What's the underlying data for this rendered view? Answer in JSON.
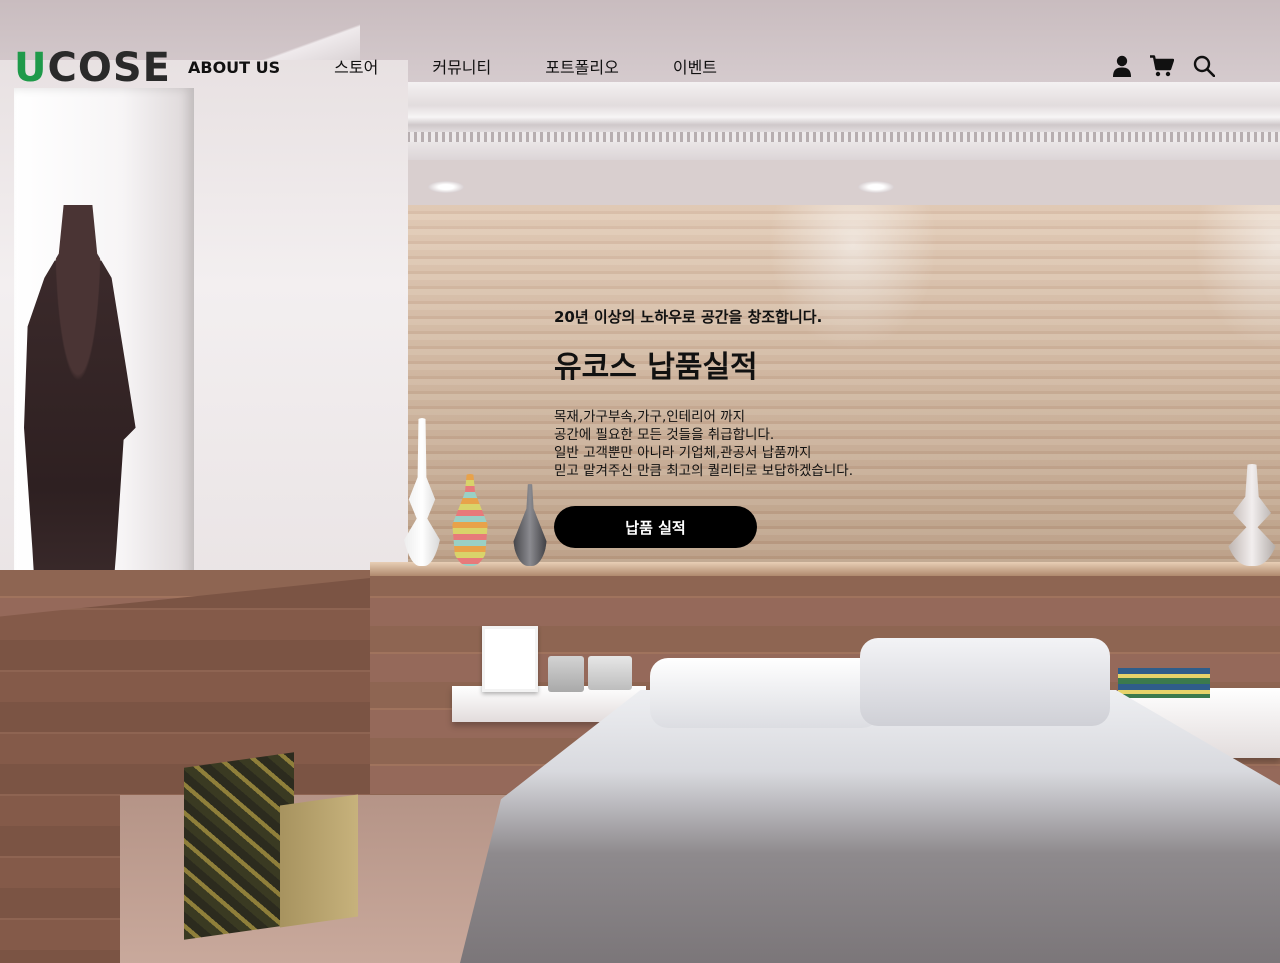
{
  "brand": {
    "logo_initial": "U",
    "logo_rest": "COSE",
    "initial_color": "#1f9a4a"
  },
  "nav": {
    "items": [
      {
        "label": "ABOUT US"
      },
      {
        "label": "스토어"
      },
      {
        "label": "커뮤니티"
      },
      {
        "label": "포트폴리오"
      },
      {
        "label": "이벤트"
      }
    ]
  },
  "header_icons": [
    "user-icon",
    "cart-icon",
    "search-icon"
  ],
  "hero": {
    "eyebrow": "20년 이상의 노하우로 공간을 창조합니다.",
    "headline": "유코스 납품실적",
    "description": [
      "목재,가구부속,가구,인테리어 까지",
      "공간에 필요한 모든 것들을 취급합니다.",
      "일반 고객뿐만 아니라 기업체,관공서 납품까지",
      "믿고 맡겨주신 만큼 최고의 퀄리티로 보답하겠습니다."
    ],
    "cta_label": "납품 실적"
  },
  "colors": {
    "text": "#111111",
    "button_bg": "#000000",
    "button_text": "#ffffff"
  }
}
